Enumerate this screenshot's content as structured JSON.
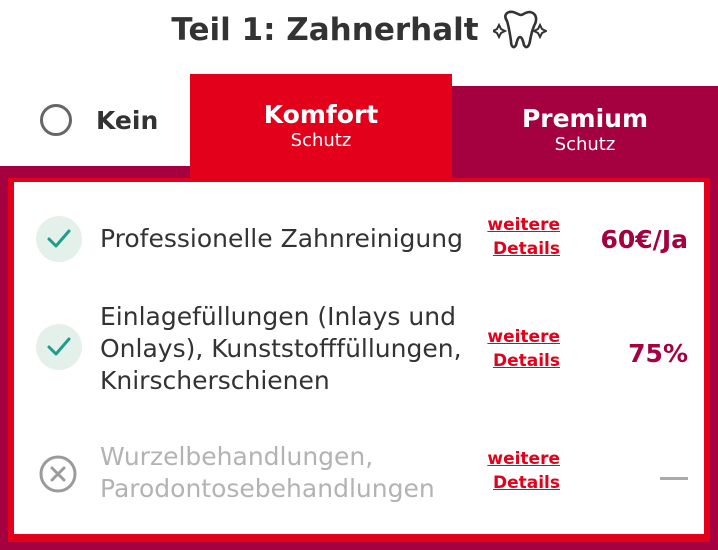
{
  "header": {
    "title": "Teil 1: Zahnerhalt",
    "icon": "sparkling-tooth-icon"
  },
  "tabs": [
    {
      "label": "Kein",
      "sublabel": "",
      "selected": false,
      "color": "#ffffff"
    },
    {
      "label": "Komfort",
      "sublabel": "Schutz",
      "selected": true,
      "color": "#e2001a"
    },
    {
      "label": "Premium",
      "sublabel": "Schutz",
      "selected": false,
      "color": "#a5003f"
    }
  ],
  "features": [
    {
      "text": "Professionelle Zahnreinigung",
      "included": true,
      "link": "weitere Details",
      "value": "60€/Ja"
    },
    {
      "text": "Einlagefüllungen (Inlays und Onlays), Kunststofffüllungen, Knirscherschienen",
      "included": true,
      "link": "weitere Details",
      "value": "75%"
    },
    {
      "text": "Wurzelbehandlungen, Parodontosebehandlungen",
      "included": false,
      "link": "weitere Details",
      "value": "—"
    }
  ],
  "colors": {
    "primary": "#e2001a",
    "secondary": "#a5003f",
    "check": "#1e9e8a"
  }
}
